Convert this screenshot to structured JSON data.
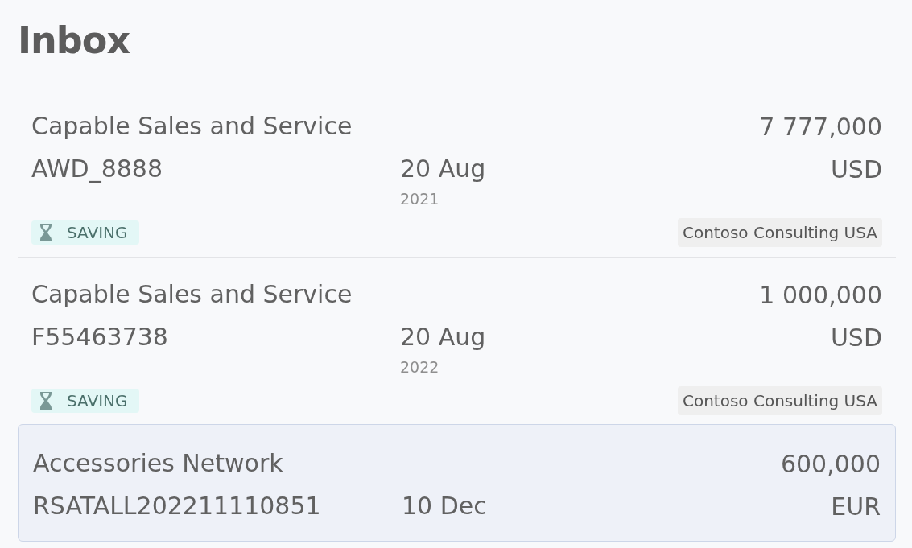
{
  "title": "Inbox",
  "items": [
    {
      "name": "Capable Sales and Service",
      "amount": "7 777,000",
      "code": "AWD_8888",
      "date": "20 Aug",
      "year": "2021",
      "currency": "USD",
      "status": "SAVING",
      "company": "Contoso Consulting USA",
      "selected": false
    },
    {
      "name": "Capable Sales and Service",
      "amount": "1 000,000",
      "code": "F55463738",
      "date": "20 Aug",
      "year": "2022",
      "currency": "USD",
      "status": "SAVING",
      "company": "Contoso Consulting USA",
      "selected": false
    },
    {
      "name": "Accessories Network",
      "amount": "600,000",
      "code": "RSATALL202211110851",
      "date": "10 Dec",
      "currency": "EUR",
      "selected": true
    }
  ]
}
